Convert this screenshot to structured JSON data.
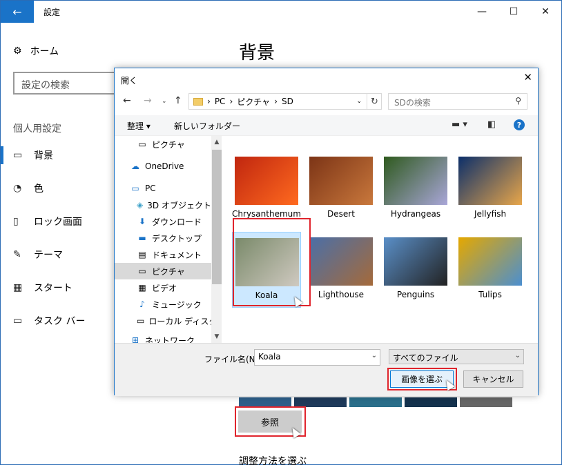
{
  "settings": {
    "window_title": "設定",
    "home_label": "ホーム",
    "search_placeholder": "設定の検索",
    "section_label": "個人用設定",
    "nav": [
      {
        "label": "背景",
        "icon": "image-icon",
        "active": true
      },
      {
        "label": "色",
        "icon": "palette-icon",
        "active": false
      },
      {
        "label": "ロック画面",
        "icon": "lock-screen-icon",
        "active": false
      },
      {
        "label": "テーマ",
        "icon": "theme-icon",
        "active": false
      },
      {
        "label": "スタート",
        "icon": "start-icon",
        "active": false
      },
      {
        "label": "タスク バー",
        "icon": "taskbar-icon",
        "active": false
      }
    ],
    "page_title": "背景",
    "browse_label": "参照",
    "fit_label": "調整方法を選ぶ"
  },
  "dialog": {
    "title": "開く",
    "breadcrumb": [
      "PC",
      "ピクチャ",
      "SD"
    ],
    "search_placeholder": "SDの検索",
    "toolbar": {
      "organize_label": "整理 ▾",
      "new_folder_label": "新しいフォルダー"
    },
    "tree": [
      {
        "label": "ピクチャ",
        "icon": "pictures-icon",
        "selected": false
      },
      {
        "label": "OneDrive",
        "icon": "onedrive-icon",
        "selected": false
      },
      {
        "label": "PC",
        "icon": "pc-icon",
        "selected": false
      },
      {
        "label": "3D オブジェクト",
        "icon": "3d-objects-icon",
        "selected": false
      },
      {
        "label": "ダウンロード",
        "icon": "download-icon",
        "selected": false
      },
      {
        "label": "デスクトップ",
        "icon": "desktop-icon",
        "selected": false
      },
      {
        "label": "ドキュメント",
        "icon": "documents-icon",
        "selected": false
      },
      {
        "label": "ピクチャ",
        "icon": "pictures-icon",
        "selected": true
      },
      {
        "label": "ビデオ",
        "icon": "video-icon",
        "selected": false
      },
      {
        "label": "ミュージック",
        "icon": "music-icon",
        "selected": false
      },
      {
        "label": "ローカル ディスク (C",
        "icon": "drive-icon",
        "selected": false
      },
      {
        "label": "ネットワーク",
        "icon": "network-icon",
        "selected": false
      }
    ],
    "files": [
      {
        "name": "Chrysanthemum",
        "colors": [
          "#c0260f",
          "#ff6a1f"
        ]
      },
      {
        "name": "Desert",
        "colors": [
          "#7c3416",
          "#c9783c"
        ]
      },
      {
        "name": "Hydrangeas",
        "colors": [
          "#2f5a1e",
          "#a9a6d8"
        ]
      },
      {
        "name": "Jellyfish",
        "colors": [
          "#0c2f6a",
          "#e8a64a"
        ]
      },
      {
        "name": "Koala",
        "colors": [
          "#7a8a6a",
          "#cfc9c0"
        ]
      },
      {
        "name": "Lighthouse",
        "colors": [
          "#4a6fa8",
          "#a56a3a"
        ]
      },
      {
        "name": "Penguins",
        "colors": [
          "#5a8fc8",
          "#222222"
        ]
      },
      {
        "name": "Tulips",
        "colors": [
          "#e5a800",
          "#4b8fd0"
        ]
      }
    ],
    "selected_file": "Koala",
    "filename_label": "ファイル名(N):",
    "filename_value": "Koala",
    "filetype_value": "すべてのファイル",
    "ok_label": "画像を選ぶ",
    "cancel_label": "キャンセル"
  }
}
